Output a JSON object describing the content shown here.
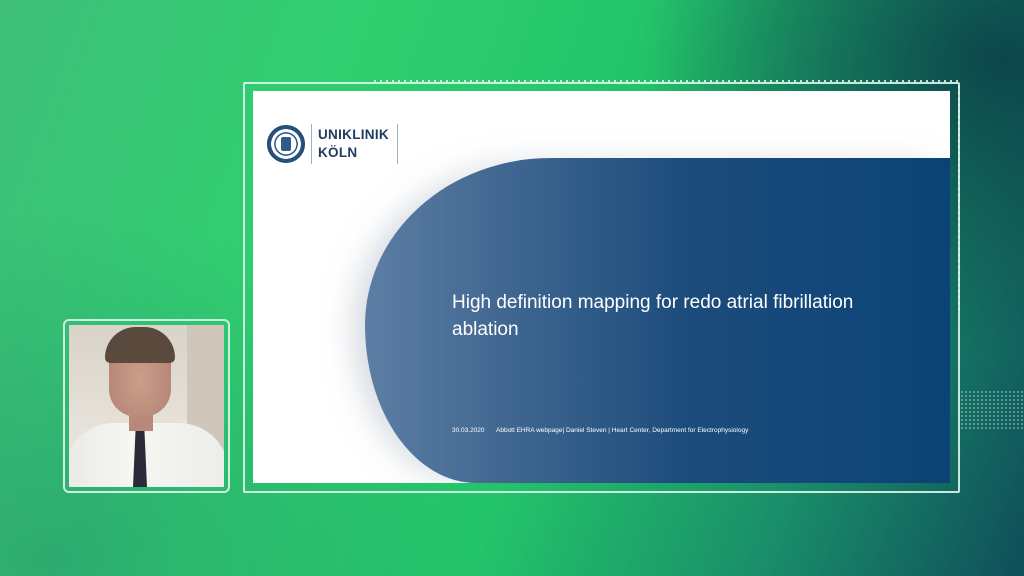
{
  "slide": {
    "logo_line1": "UNIKLINIK",
    "logo_line2": "KÖLN",
    "title": "High definition mapping for redo atrial fibrillation ablation",
    "footer": {
      "date": "30.03.2020",
      "info": "Abbott EHRA webpage| Daniel Steven | Heart Center, Department for Electrophysiology"
    }
  },
  "presenter": {
    "icon": "presenter-video-thumbnail"
  },
  "colors": {
    "background_green": "#2fcf6f",
    "slide_blue": "#0b4376",
    "logo_blue": "#1f3d62"
  }
}
